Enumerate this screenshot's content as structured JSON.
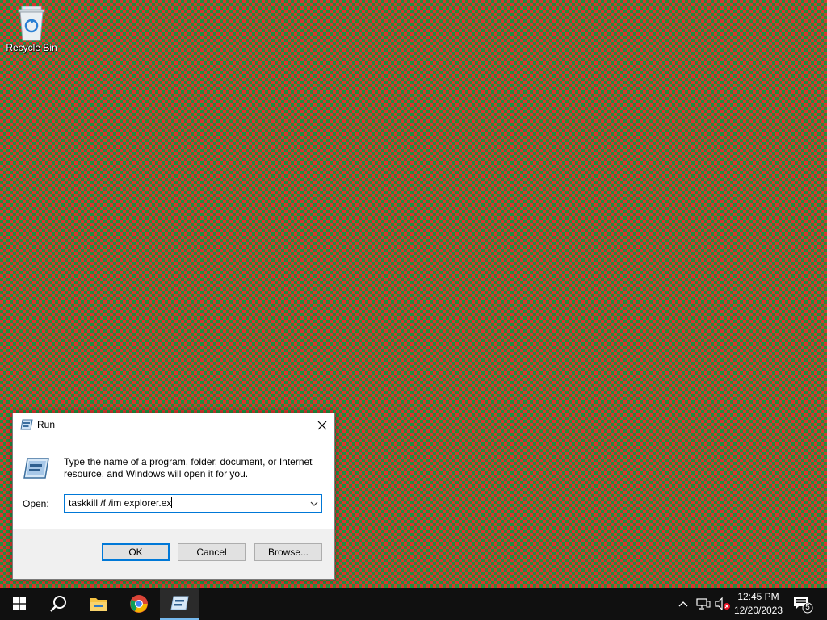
{
  "desktop": {
    "icons": [
      {
        "label": "Recycle Bin",
        "icon": "recycle-bin-icon"
      }
    ]
  },
  "run_dialog": {
    "title": "Run",
    "description": "Type the name of a program, folder, document, or Internet resource, and Windows will open it for you.",
    "open_label": "Open:",
    "command_value": "taskkill /f /im explorer.ex",
    "buttons": {
      "ok": "OK",
      "cancel": "Cancel",
      "browse": "Browse..."
    }
  },
  "taskbar": {
    "pinned": [
      {
        "name": "start",
        "icon": "windows-logo-icon"
      },
      {
        "name": "search",
        "icon": "search-icon"
      },
      {
        "name": "file-explorer",
        "icon": "folder-icon"
      },
      {
        "name": "chrome",
        "icon": "chrome-icon"
      },
      {
        "name": "run",
        "icon": "run-icon",
        "active": true
      }
    ],
    "tray": {
      "time": "12:45 PM",
      "date": "12/20/2023",
      "notification_count": "5"
    }
  },
  "colors": {
    "accent": "#0078d7",
    "taskbar": "#101010",
    "wallpaper_red": "#d8362f",
    "wallpaper_green": "#1f8f3f"
  }
}
